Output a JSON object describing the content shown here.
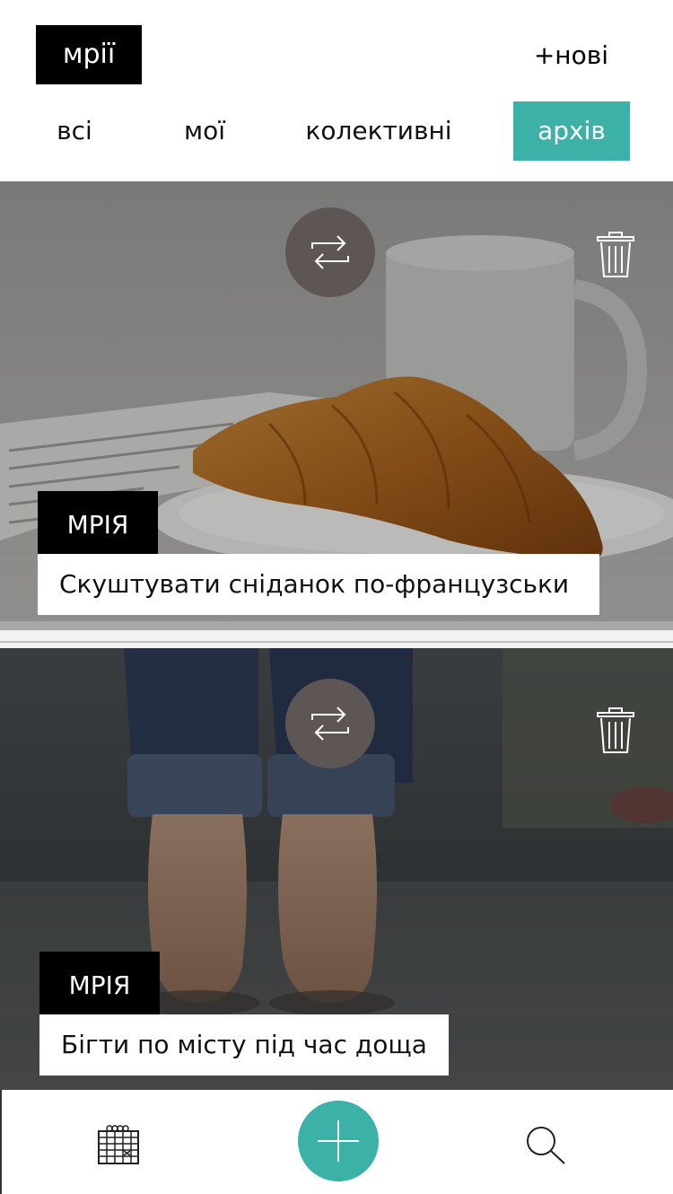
{
  "header": {
    "logo": "мрії",
    "new_link": "+нові"
  },
  "tabs": [
    {
      "label": "всі",
      "active": false
    },
    {
      "label": "мої",
      "active": false
    },
    {
      "label": "колективні",
      "active": false
    },
    {
      "label": "архів",
      "active": true
    }
  ],
  "cards": [
    {
      "badge": "МРІЯ",
      "caption": "Скуштувати сніданок по-французськи",
      "image": "croissant-breakfast-photo"
    },
    {
      "badge": "МРІЯ",
      "caption": "Бігти по місту під час доща",
      "image": "barefoot-rain-photo"
    }
  ],
  "icons": {
    "repeat": "repeat-icon",
    "trash": "trash-icon",
    "calendar": "calendar-icon",
    "add": "plus-icon",
    "search": "search-icon"
  },
  "colors": {
    "accent": "#3bb1a7",
    "repeat_button": "#5d5654",
    "badge": "#000000"
  }
}
